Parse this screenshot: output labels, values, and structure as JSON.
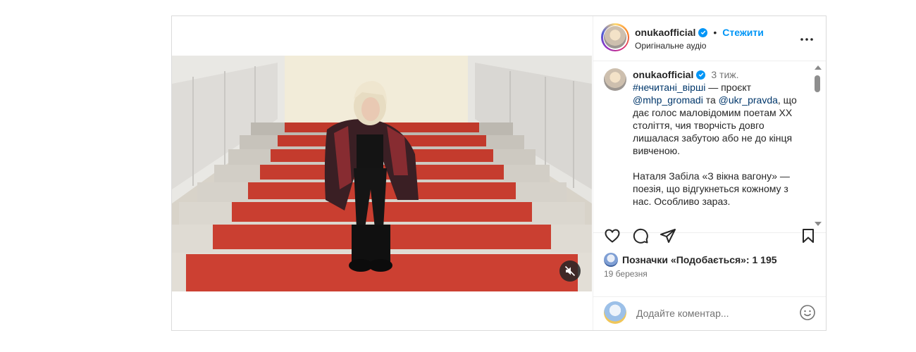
{
  "post": {
    "username": "onukaofficial",
    "header": {
      "follow_separator": "•",
      "follow_label": "Стежити",
      "audio_label": "Оригінальне аудіо"
    },
    "caption": {
      "time": "3 тиж.",
      "line1_hashtag": "#нечитані_вірші",
      "line1_text": " — проєкт ",
      "mention1": "@mhp_gromadi",
      "mid_text": " та ",
      "mention2": "@ukr_pravda",
      "rest_text": ", що дає голос маловідомим поетам ХХ століття, чия творчість довго лишалася забутою або не до кінця вивченою.",
      "paragraph2": "Наталя Забіла «З вікна вагону» — поезія, що відгукнеться кожному з нас. Особливо зараз."
    },
    "likes_text": "Позначки «Подобається»: 1 195",
    "date": "19 березня",
    "comment_placeholder": "Додайте коментар..."
  },
  "icons": {
    "verified": "verified-badge-icon",
    "more": "more-options-icon",
    "like": "heart-icon",
    "comment": "comment-bubble-icon",
    "share": "paper-plane-icon",
    "save": "bookmark-icon",
    "mute": "speaker-muted-icon",
    "emoji": "smiley-icon"
  },
  "colors": {
    "accent": "#0095f6",
    "link": "#00376b",
    "muted": "#737373",
    "border": "#dbdbdb"
  }
}
